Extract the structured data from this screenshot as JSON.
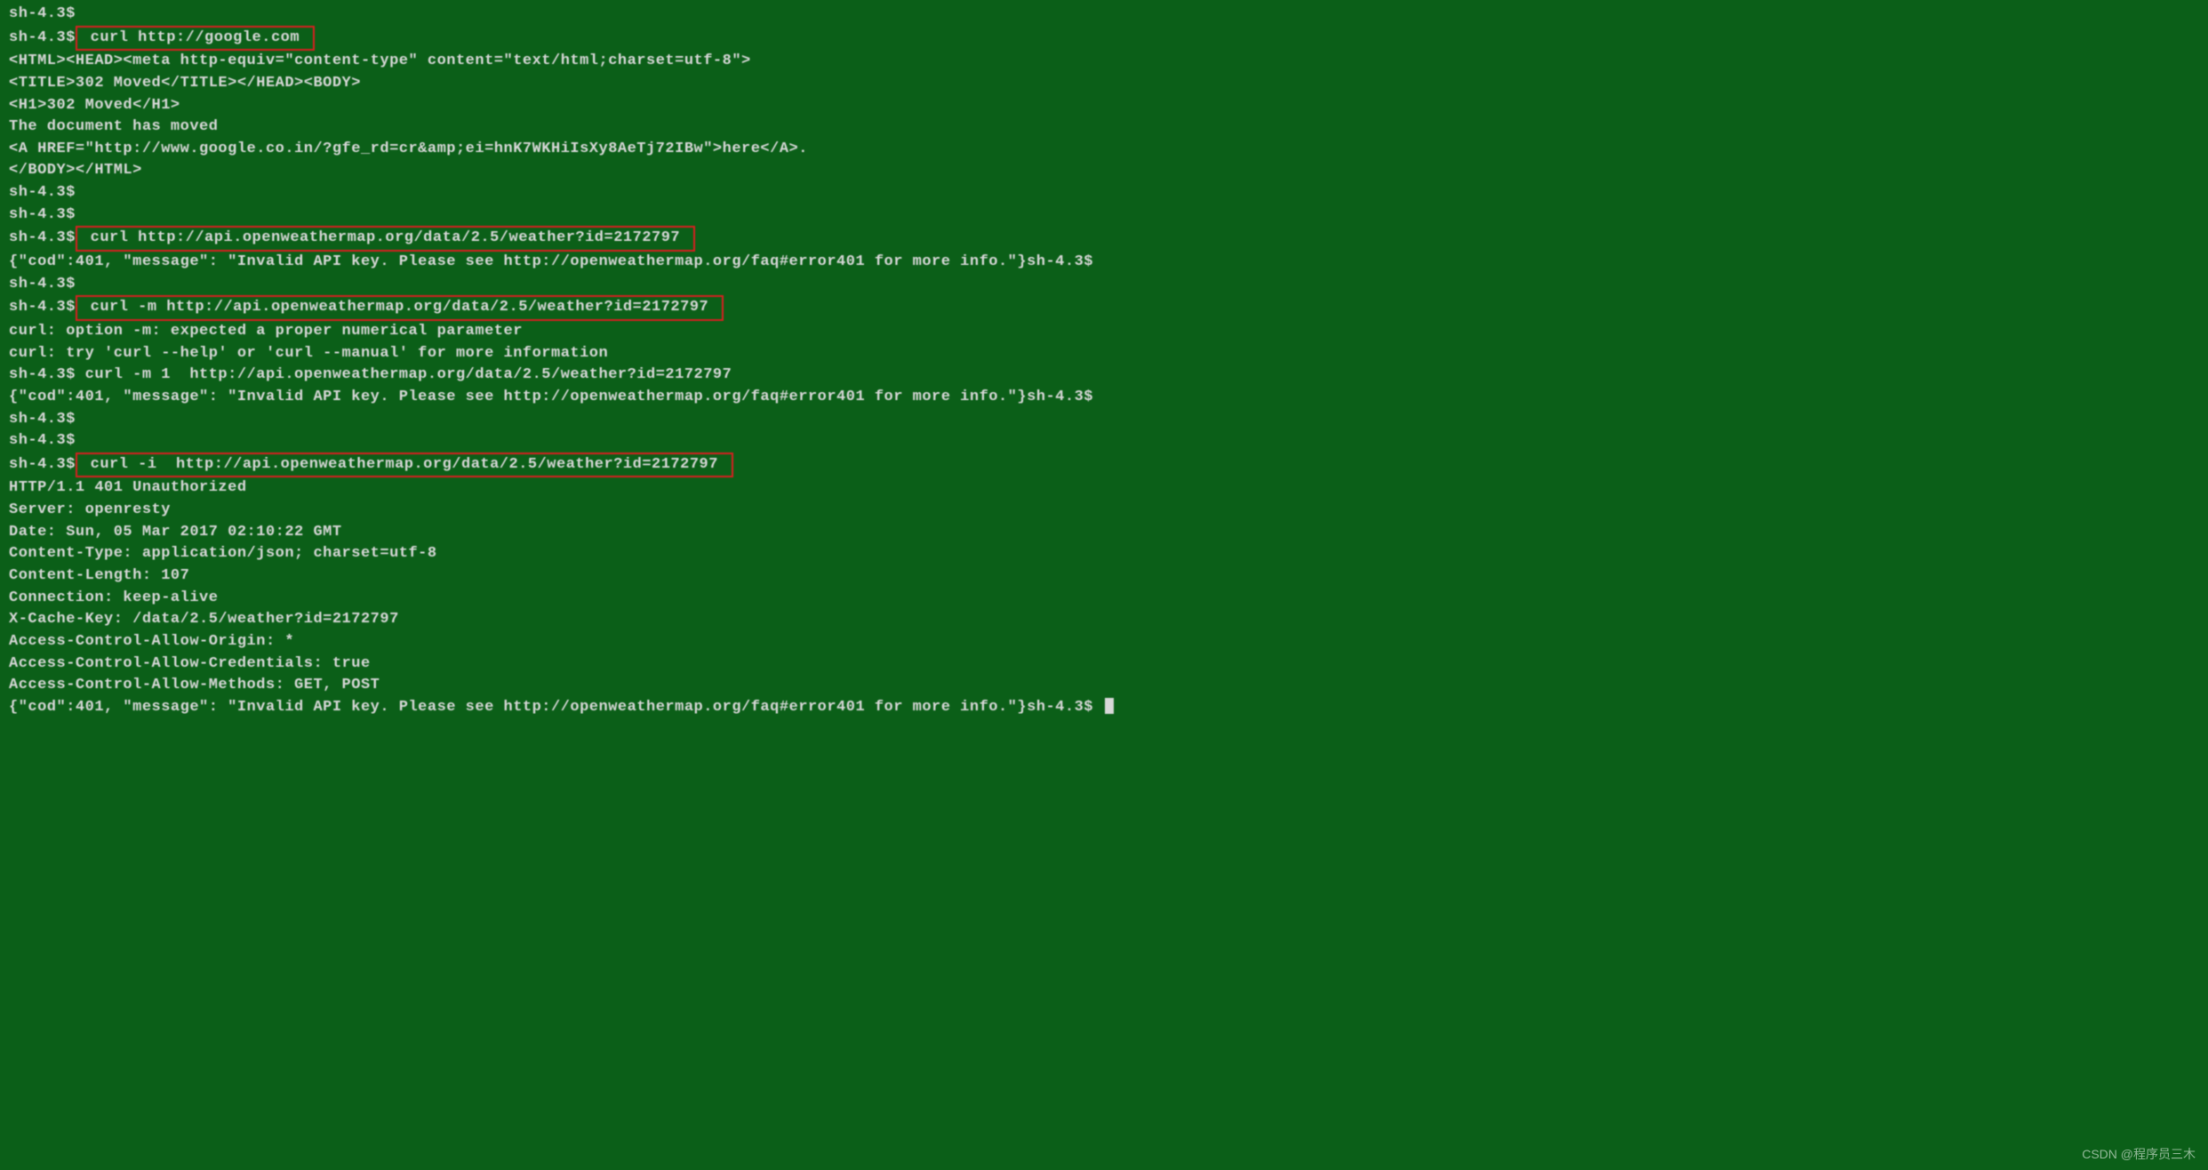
{
  "prompt": "sh-4.3$",
  "cmd1": " curl http://google.com ",
  "out1": [
    "<HTML><HEAD><meta http-equiv=\"content-type\" content=\"text/html;charset=utf-8\">",
    "<TITLE>302 Moved</TITLE></HEAD><BODY>",
    "<H1>302 Moved</H1>",
    "The document has moved",
    "<A HREF=\"http://www.google.co.in/?gfe_rd=cr&amp;ei=hnK7WKHiIsXy8AeTj72IBw\">here</A>.",
    "</BODY></HTML>"
  ],
  "cmd2": " curl http://api.openweathermap.org/data/2.5/weather?id=2172797 ",
  "out2_inline": "{\"cod\":401, \"message\": \"Invalid API key. Please see http://openweathermap.org/faq#error401 for more info.\"}sh-4.3$",
  "cmd3": " curl -m http://api.openweathermap.org/data/2.5/weather?id=2172797 ",
  "out3": [
    "curl: option -m: expected a proper numerical parameter",
    "curl: try 'curl --help' or 'curl --manual' for more information"
  ],
  "cmd3b": "sh-4.3$ curl -m 1  http://api.openweathermap.org/data/2.5/weather?id=2172797",
  "out3b_inline": "{\"cod\":401, \"message\": \"Invalid API key. Please see http://openweathermap.org/faq#error401 for more info.\"}sh-4.3$",
  "cmd4": " curl -i  http://api.openweathermap.org/data/2.5/weather?id=2172797 ",
  "out4": [
    "HTTP/1.1 401 Unauthorized",
    "Server: openresty",
    "Date: Sun, 05 Mar 2017 02:10:22 GMT",
    "Content-Type: application/json; charset=utf-8",
    "Content-Length: 107",
    "Connection: keep-alive",
    "X-Cache-Key: /data/2.5/weather?id=2172797",
    "Access-Control-Allow-Origin: *",
    "Access-Control-Allow-Credentials: true",
    "Access-Control-Allow-Methods: GET, POST",
    "",
    "{\"cod\":401, \"message\": \"Invalid API key. Please see http://openweathermap.org/faq#error401 for more info.\"}sh-4.3$ "
  ],
  "watermark": "CSDN @程序员三木"
}
